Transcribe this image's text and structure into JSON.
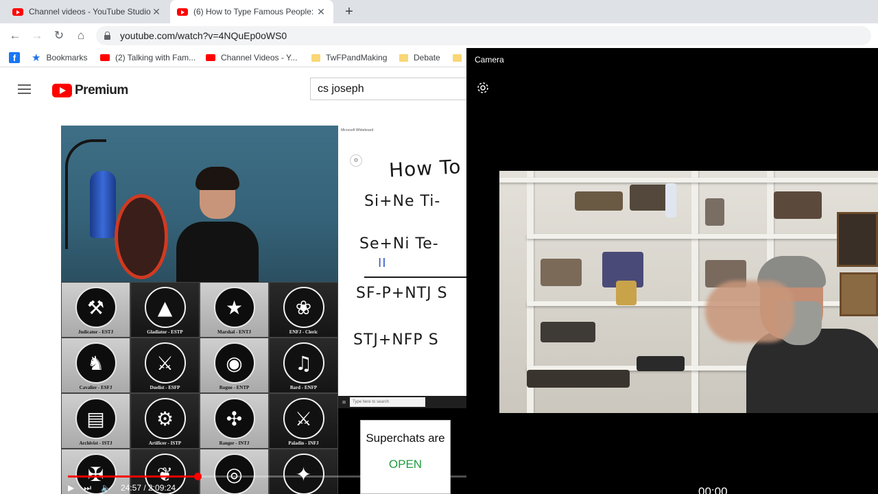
{
  "browser": {
    "tabs": [
      {
        "title": "Channel videos - YouTube Studio"
      },
      {
        "title": "(6) How to Type Famous People: Ezra Klein -"
      }
    ],
    "url": "youtube.com/watch?v=4NQuEp0oWS0",
    "bookmarks": [
      {
        "label": "Bookmarks",
        "icon": "star-icon"
      },
      {
        "label": "(2) Talking with Fam...",
        "icon": "youtube-icon"
      },
      {
        "label": "Channel Videos - Y...",
        "icon": "youtube-icon"
      },
      {
        "label": "TwFPandMaking",
        "icon": "folder-icon"
      },
      {
        "label": "Debate",
        "icon": "folder-icon"
      }
    ]
  },
  "youtube": {
    "logo_text": "Premium",
    "search_value": "cs joseph",
    "player": {
      "time": "24:57 / 2:09:24",
      "progress_fraction": 0.09
    },
    "archetypes": [
      {
        "label": "Judicator - ESTJ",
        "glyph": "⚒",
        "tone": "light"
      },
      {
        "label": "Gladiator - ESTP",
        "glyph": "▲",
        "tone": "dark"
      },
      {
        "label": "Marshal - ENTJ",
        "glyph": "★",
        "tone": "light"
      },
      {
        "label": "ENFJ - Cleric",
        "glyph": "❀",
        "tone": "dark"
      },
      {
        "label": "Cavalier - ESFJ",
        "glyph": "♞",
        "tone": "light"
      },
      {
        "label": "Duelist - ESFP",
        "glyph": "⚔",
        "tone": "dark"
      },
      {
        "label": "Rogue - ENTP",
        "glyph": "◉",
        "tone": "light"
      },
      {
        "label": "Bard - ENFP",
        "glyph": "♫",
        "tone": "dark"
      },
      {
        "label": "Archivist - ISTJ",
        "glyph": "▤",
        "tone": "light"
      },
      {
        "label": "Artificer - ISTP",
        "glyph": "⚙",
        "tone": "dark"
      },
      {
        "label": "Ranger - INTJ",
        "glyph": "✣",
        "tone": "light"
      },
      {
        "label": "Paladin - INFJ",
        "glyph": "⚔",
        "tone": "dark"
      },
      {
        "label": "",
        "glyph": "✠",
        "tone": "light"
      },
      {
        "label": "",
        "glyph": "❦",
        "tone": "dark"
      },
      {
        "label": "",
        "glyph": "◎",
        "tone": "light"
      },
      {
        "label": "",
        "glyph": "✦",
        "tone": "dark"
      }
    ],
    "whiteboard": {
      "window_title": "Microsoft Whiteboard",
      "lines": [
        "How To",
        "Si+Ne  Ti-",
        "Se+Ni  Te-",
        "II",
        "SF-P+NTJ S",
        "STJ+NFP S"
      ]
    },
    "taskbar_search": "Type here to search",
    "superchat": {
      "line1": "Superchats are",
      "line2": "OPEN"
    }
  },
  "camera": {
    "title": "Camera",
    "timer": "00:00"
  }
}
